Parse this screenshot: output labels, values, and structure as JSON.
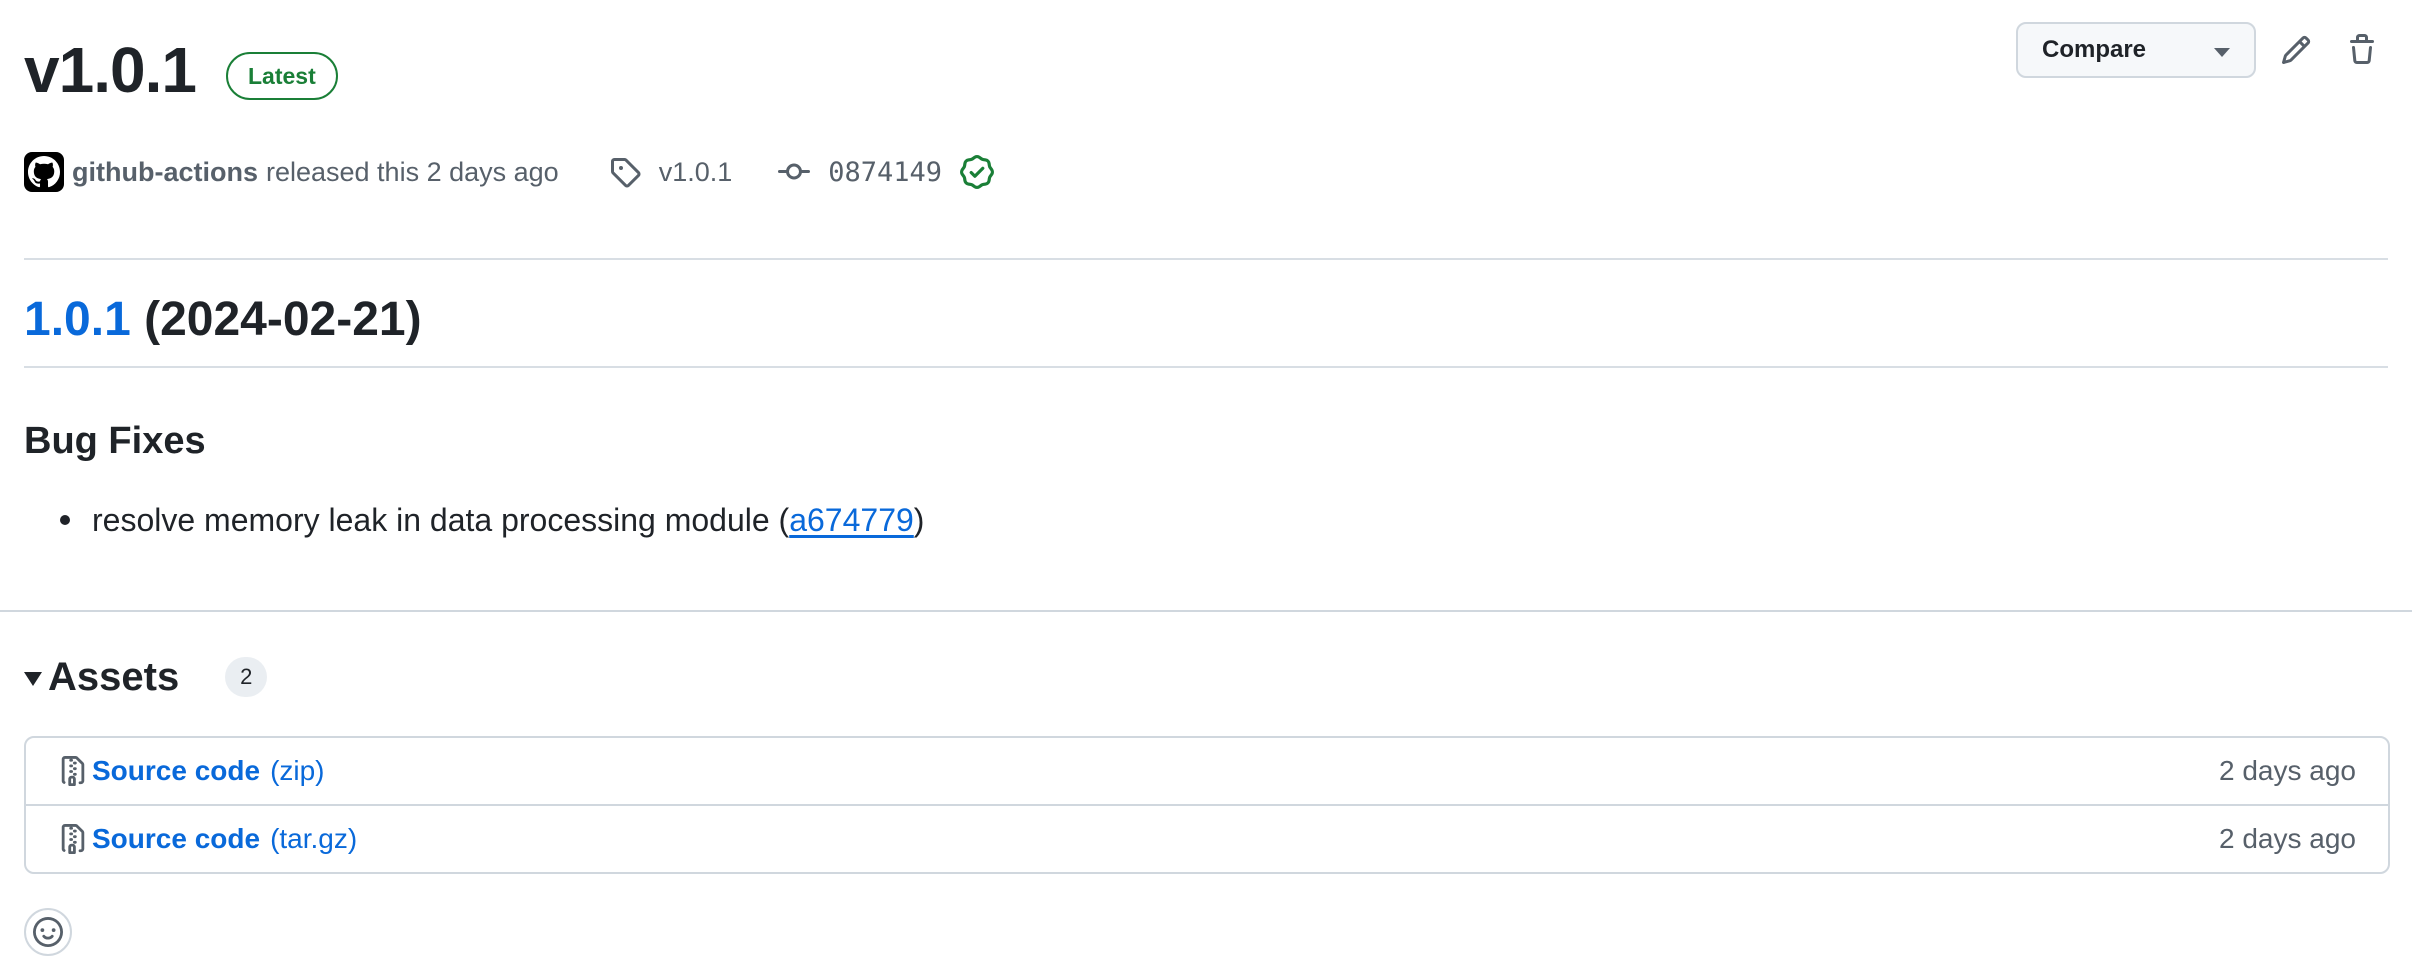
{
  "release": {
    "title": "v1.0.1",
    "badge": "Latest",
    "author": "github-actions",
    "released_text": "released this 2 days ago",
    "tag": "v1.0.1",
    "commit": "0874149"
  },
  "actions": {
    "compare_label": "Compare"
  },
  "notes": {
    "version_link": "1.0.1",
    "version_date": "(2024-02-21)",
    "section_title": "Bug Fixes",
    "items": [
      {
        "text": "resolve memory leak in data processing module (",
        "commit": "a674779",
        "suffix": ")"
      }
    ]
  },
  "assets": {
    "title": "Assets",
    "count": "2",
    "items": [
      {
        "name": "Source code",
        "ext": "(zip)",
        "date": "2 days ago"
      },
      {
        "name": "Source code",
        "ext": "(tar.gz)",
        "date": "2 days ago"
      }
    ]
  },
  "icons": {
    "avatar": "github-logo-icon",
    "tag": "tag-icon",
    "commit": "git-commit-icon",
    "verified": "verified-check-icon",
    "edit": "pencil-icon",
    "delete": "trash-icon",
    "asset": "file-zip-icon",
    "reaction": "smiley-icon"
  },
  "colors": {
    "accent": "#0969da",
    "success": "#1a7f37",
    "muted": "#57606a",
    "border": "#d0d7de"
  }
}
